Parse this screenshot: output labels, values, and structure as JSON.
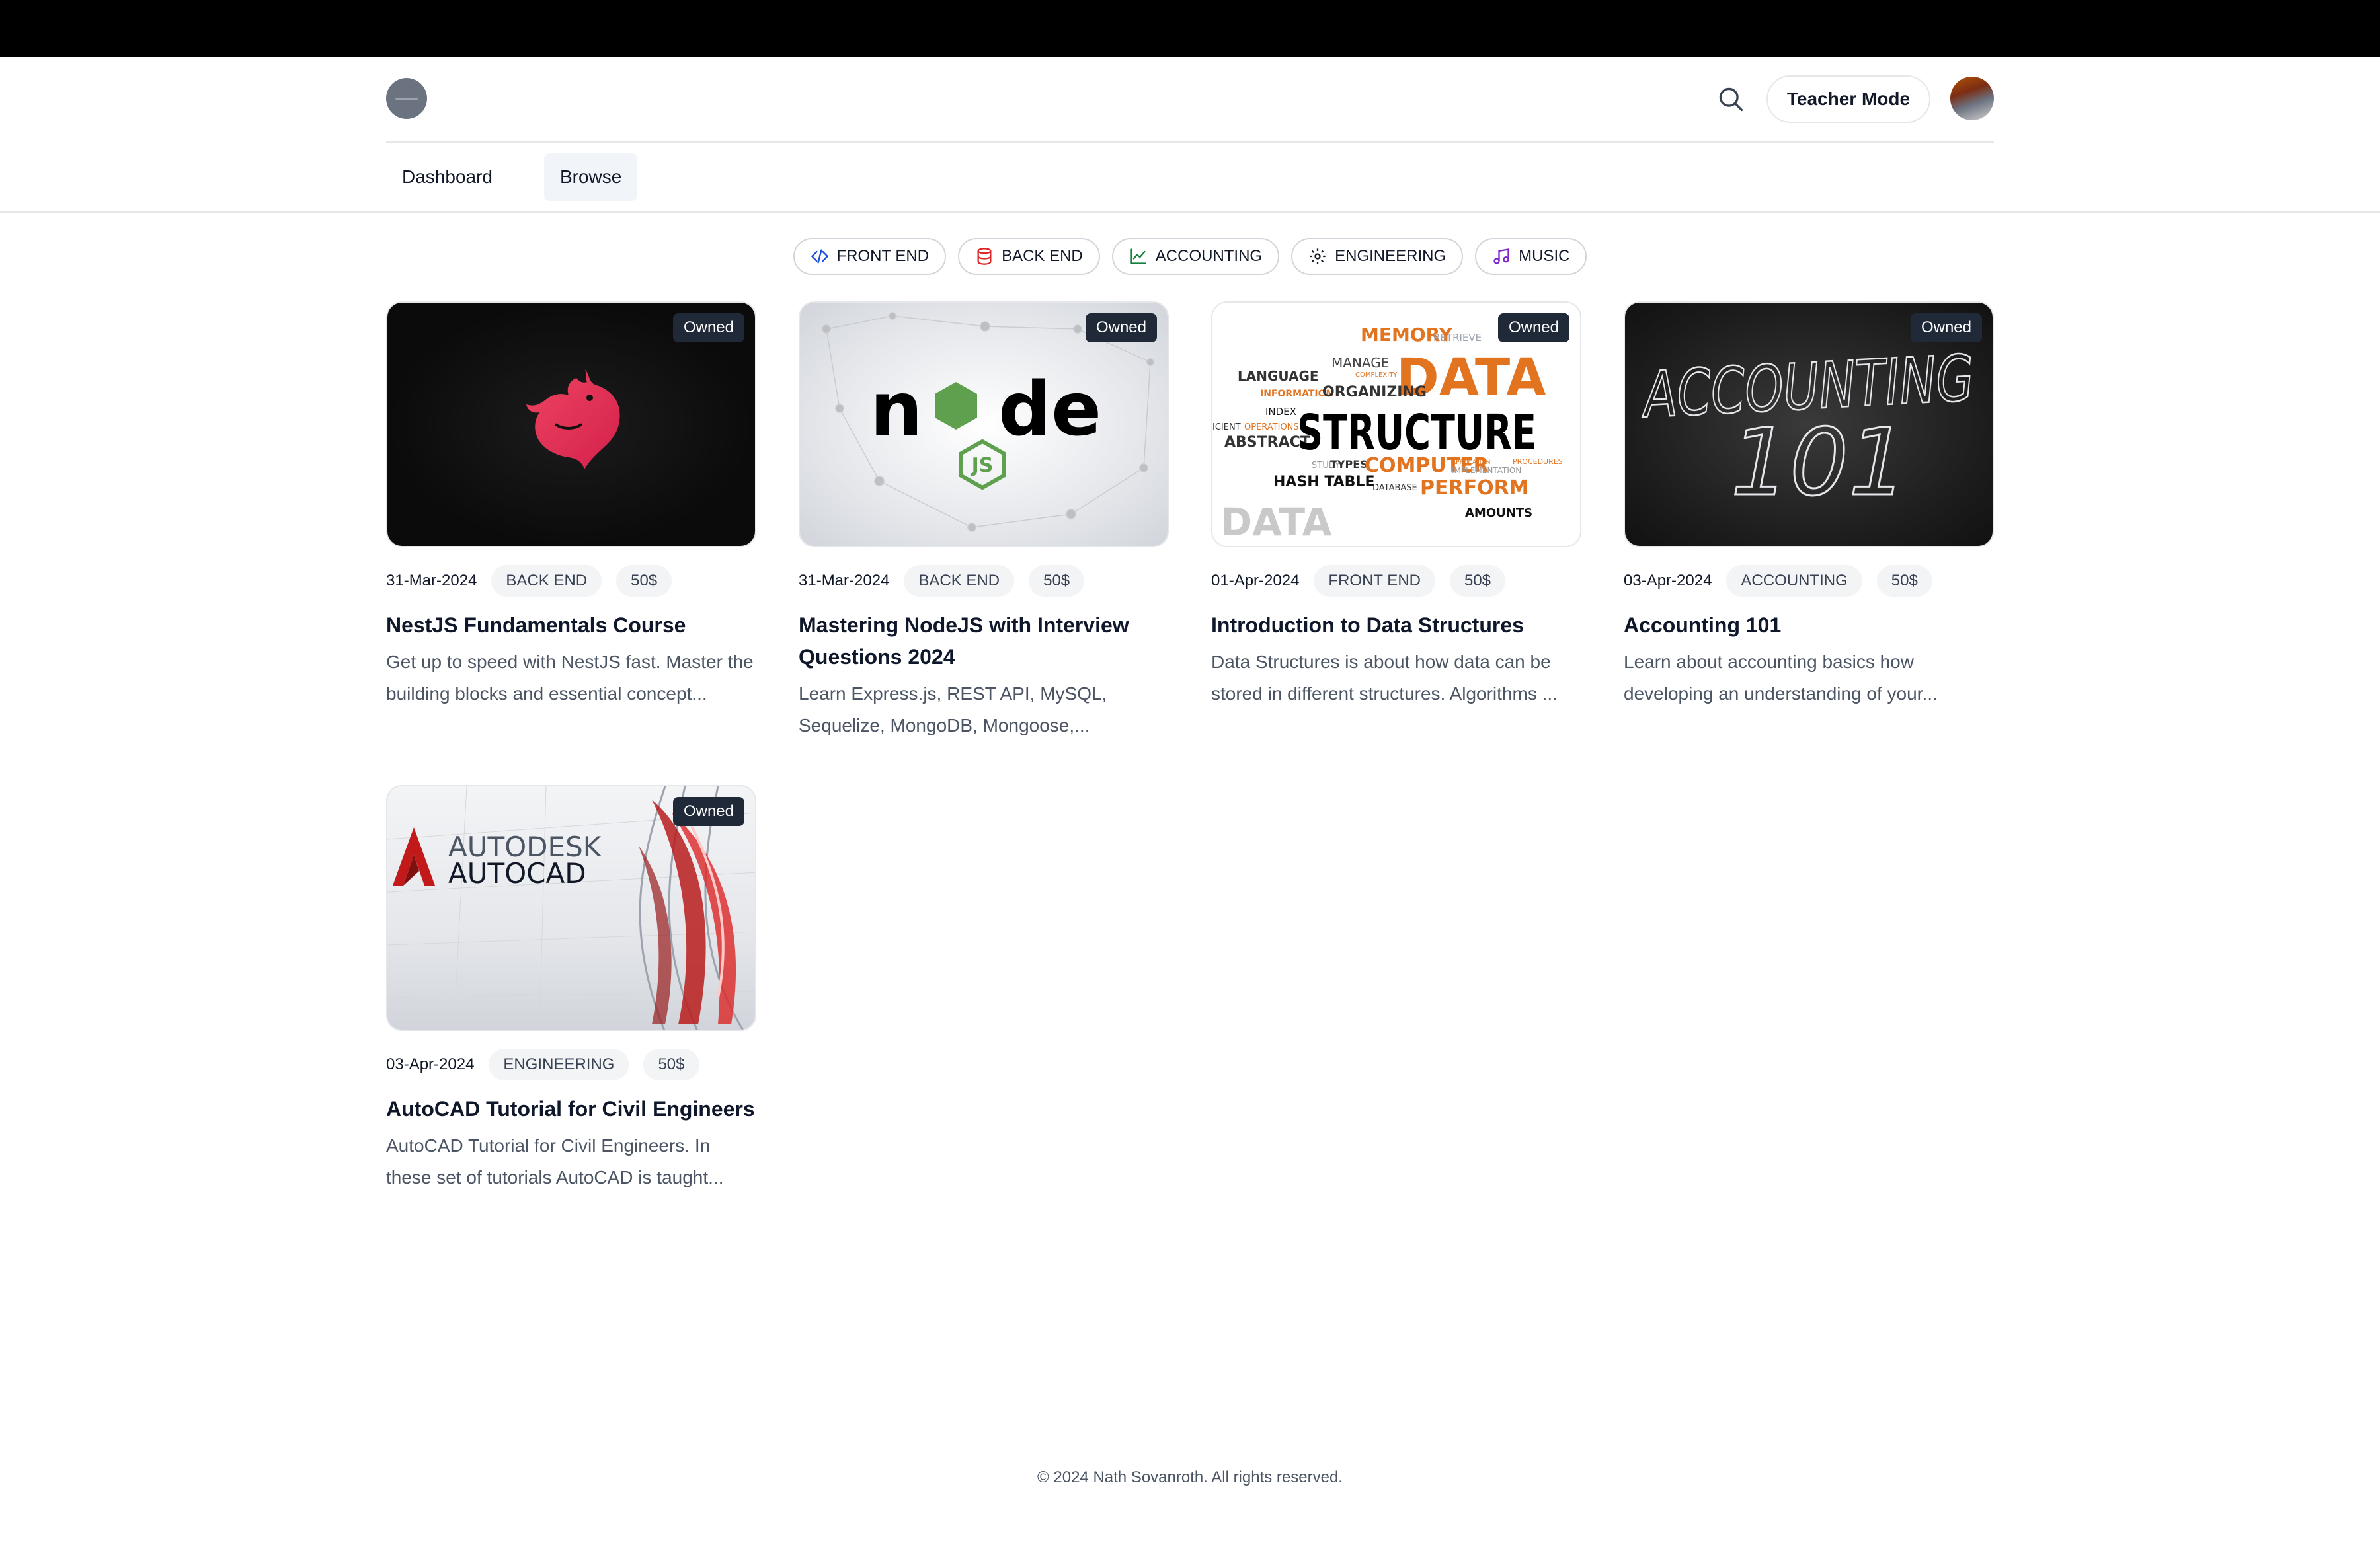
{
  "header": {
    "teacher_mode_label": "Teacher Mode"
  },
  "nav": {
    "items": [
      {
        "label": "Dashboard"
      },
      {
        "label": "Browse"
      }
    ]
  },
  "categories": [
    {
      "label": "FRONT END",
      "icon": "code-icon",
      "color": "#1d4ed8"
    },
    {
      "label": "BACK END",
      "icon": "database-icon",
      "color": "#dc2626"
    },
    {
      "label": "ACCOUNTING",
      "icon": "chart-icon",
      "color": "#15803d"
    },
    {
      "label": "ENGINEERING",
      "icon": "gear-icon",
      "color": "#111827"
    },
    {
      "label": "MUSIC",
      "icon": "music-icon",
      "color": "#7e22ce"
    }
  ],
  "courses": [
    {
      "badge": "Owned",
      "date": "31-Mar-2024",
      "category": "BACK END",
      "price": "50$",
      "title": "NestJS Fundamentals Course",
      "description": "Get up to speed with NestJS fast. Master the building blocks and essential concept..."
    },
    {
      "badge": "Owned",
      "date": "31-Mar-2024",
      "category": "BACK END",
      "price": "50$",
      "title": "Mastering NodeJS with Interview Questions 2024",
      "description": "Learn Express.js, REST API, MySQL, Sequelize, MongoDB, Mongoose,...",
      "image_text": {
        "wordmark_left": "n",
        "wordmark_right": "de",
        "badge": "JS"
      }
    },
    {
      "badge": "Owned",
      "date": "01-Apr-2024",
      "category": "FRONT END",
      "price": "50$",
      "title": "Introduction to Data Structures",
      "description": "Data Structures is about how data can be stored in different structures. Algorithms ...",
      "image_text": {
        "memory": "MEMORY",
        "retrieve": "RETRIEVE",
        "manage": "MANAGE",
        "complexity": "COMPLEXITY",
        "language": "LANGUAGE",
        "information": "INFORMATION",
        "organizing": "ORGANIZING",
        "data": "DATA",
        "index": "INDEX",
        "operations": "OPERATIONS",
        "efficient": "ICIENT",
        "abstract": "ABSTRACT",
        "structure": "STRUCTURE",
        "types": "TYPES",
        "computer": "COMPUTER",
        "application": "APPLICATION",
        "implementation": "IMPLEMENTATION",
        "procedures": "PROCEDURES",
        "hash_table": "HASH TABLE",
        "database": "DATABASE",
        "perform": "PERFORM",
        "data_big": "DATA",
        "amounts": "AMOUNTS",
        "study": "STUDY"
      }
    },
    {
      "badge": "Owned",
      "date": "03-Apr-2024",
      "category": "ACCOUNTING",
      "price": "50$",
      "title": "Accounting 101",
      "description": "Learn about accounting basics how developing an understanding of your...",
      "image_text": {
        "line1": "ACCOUNTING",
        "line2": "101"
      }
    },
    {
      "badge": "Owned",
      "date": "03-Apr-2024",
      "category": "ENGINEERING",
      "price": "50$",
      "title": "AutoCAD Tutorial for Civil Engineers",
      "description": "AutoCAD Tutorial for Civil Engineers. In these set of tutorials AutoCAD is taught...",
      "image_text": {
        "line1": "AUTODESK",
        "line2": "AUTOCAD"
      }
    }
  ],
  "footer": {
    "copyright": "© 2024 Nath Sovanroth. All rights reserved."
  }
}
